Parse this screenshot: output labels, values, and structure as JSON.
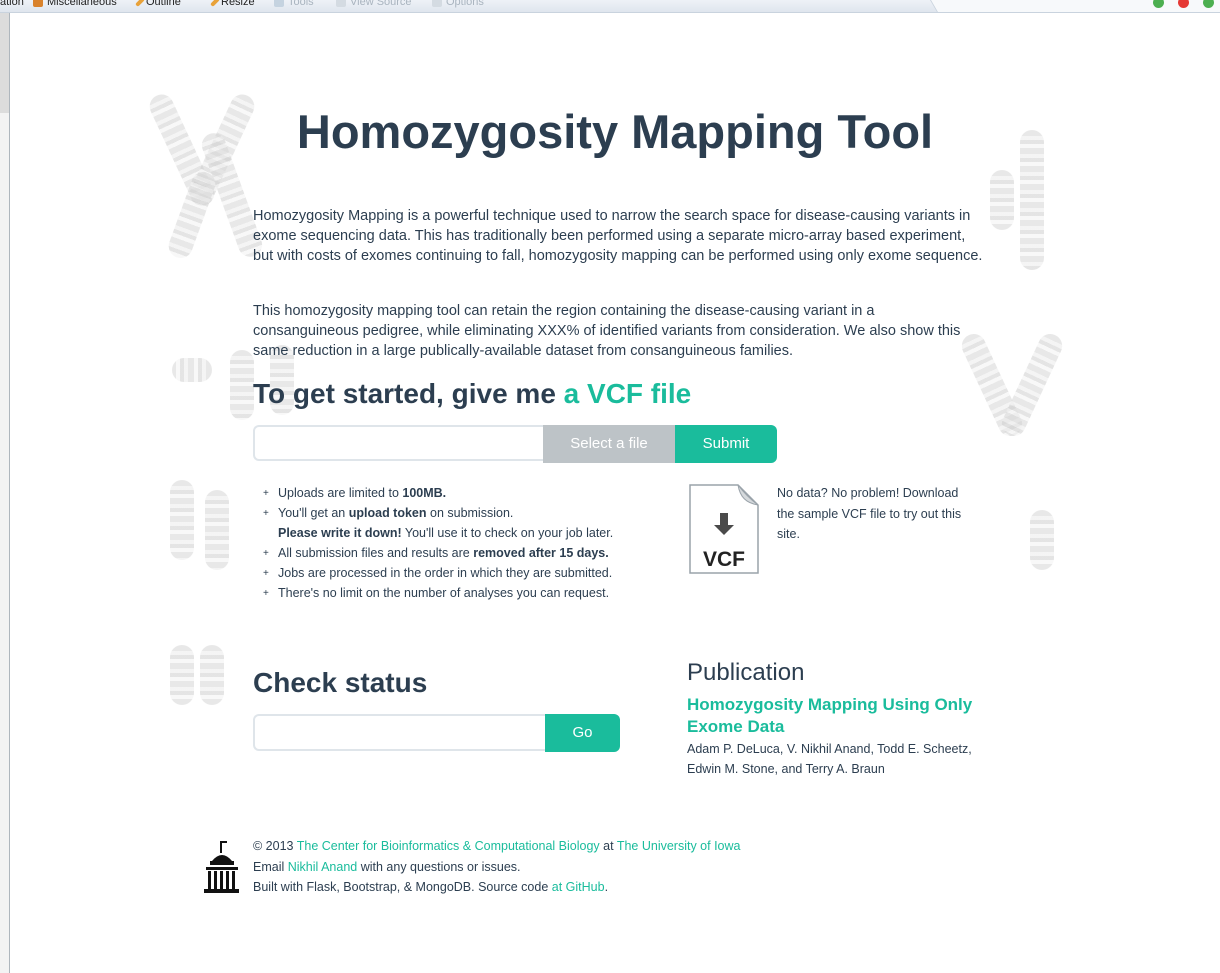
{
  "browser_toolbar": {
    "items": [
      {
        "label": "ation",
        "enabled": true
      },
      {
        "label": "Miscellaneous",
        "enabled": true
      },
      {
        "label": "Outline",
        "enabled": true
      },
      {
        "label": "Resize",
        "enabled": true
      },
      {
        "label": "Tools",
        "enabled": false
      },
      {
        "label": "View Source",
        "enabled": false
      },
      {
        "label": "Options",
        "enabled": false
      }
    ]
  },
  "page": {
    "title": "Homozygosity Mapping Tool",
    "intro_1": "Homozygosity Mapping is a powerful technique used to narrow the search space for disease-causing variants in exome sequencing data. This has traditionally been performed using a separate micro-array based experiment, but with costs of exomes continuing to fall, homozygosity mapping can be performed using only exome sequence.",
    "intro_2": "This homozygosity mapping tool can retain the region containing the disease-causing variant in a consanguineous pedigree, while eliminating XXX% of identified variants from consideration. We also show this same reduction in a large publically-available dataset from consanguineous families."
  },
  "upload": {
    "heading": "To get started, give me",
    "heading_accent": "a VCF file",
    "file_value": "",
    "select_label": "Select a file",
    "submit_label": "Submit"
  },
  "notes": {
    "n1_pre": "Uploads are limited to ",
    "n1_bold": "100MB.",
    "n2_pre": "You'll get an ",
    "n2_bold": "upload token",
    "n2_post": " on submission.",
    "n3_bold": "Please write it down!",
    "n3_post": " You'll use it to check on your job later.",
    "n4_pre": "All submission files and results are ",
    "n4_bold": "removed after 15 days.",
    "n5": "Jobs are processed in the order in which they are submitted.",
    "n6": "There's no limit on the number of analyses you can request."
  },
  "sample": {
    "icon_label": "VCF",
    "text": "No data? No problem! Download the sample VCF file to try out this site."
  },
  "status": {
    "heading": "Check status",
    "token_value": "",
    "go_label": "Go"
  },
  "publication": {
    "heading": "Publication",
    "link_text": "Homozygosity Mapping Using Only Exome Data",
    "authors": "Adam P. DeLuca, V. Nikhil Anand, Todd E. Scheetz, Edwin M. Stone, and Terry A. Braun"
  },
  "footer": {
    "copyright": "© 2013 ",
    "cbcb_link": "The Center for Bioinformatics & Computational Biology",
    "at": " at ",
    "uiowa_link": "The University of Iowa",
    "email_pre": "Email ",
    "email_link": "Nikhil Anand",
    "email_post": " with any questions or issues.",
    "built_with": "Built with Flask, Bootstrap, & MongoDB. Source code ",
    "github_link": "at GitHub",
    "period": "."
  },
  "colors": {
    "accent": "#1abc9c",
    "text": "#2c3e50",
    "muted_button": "#bdc3c7"
  }
}
